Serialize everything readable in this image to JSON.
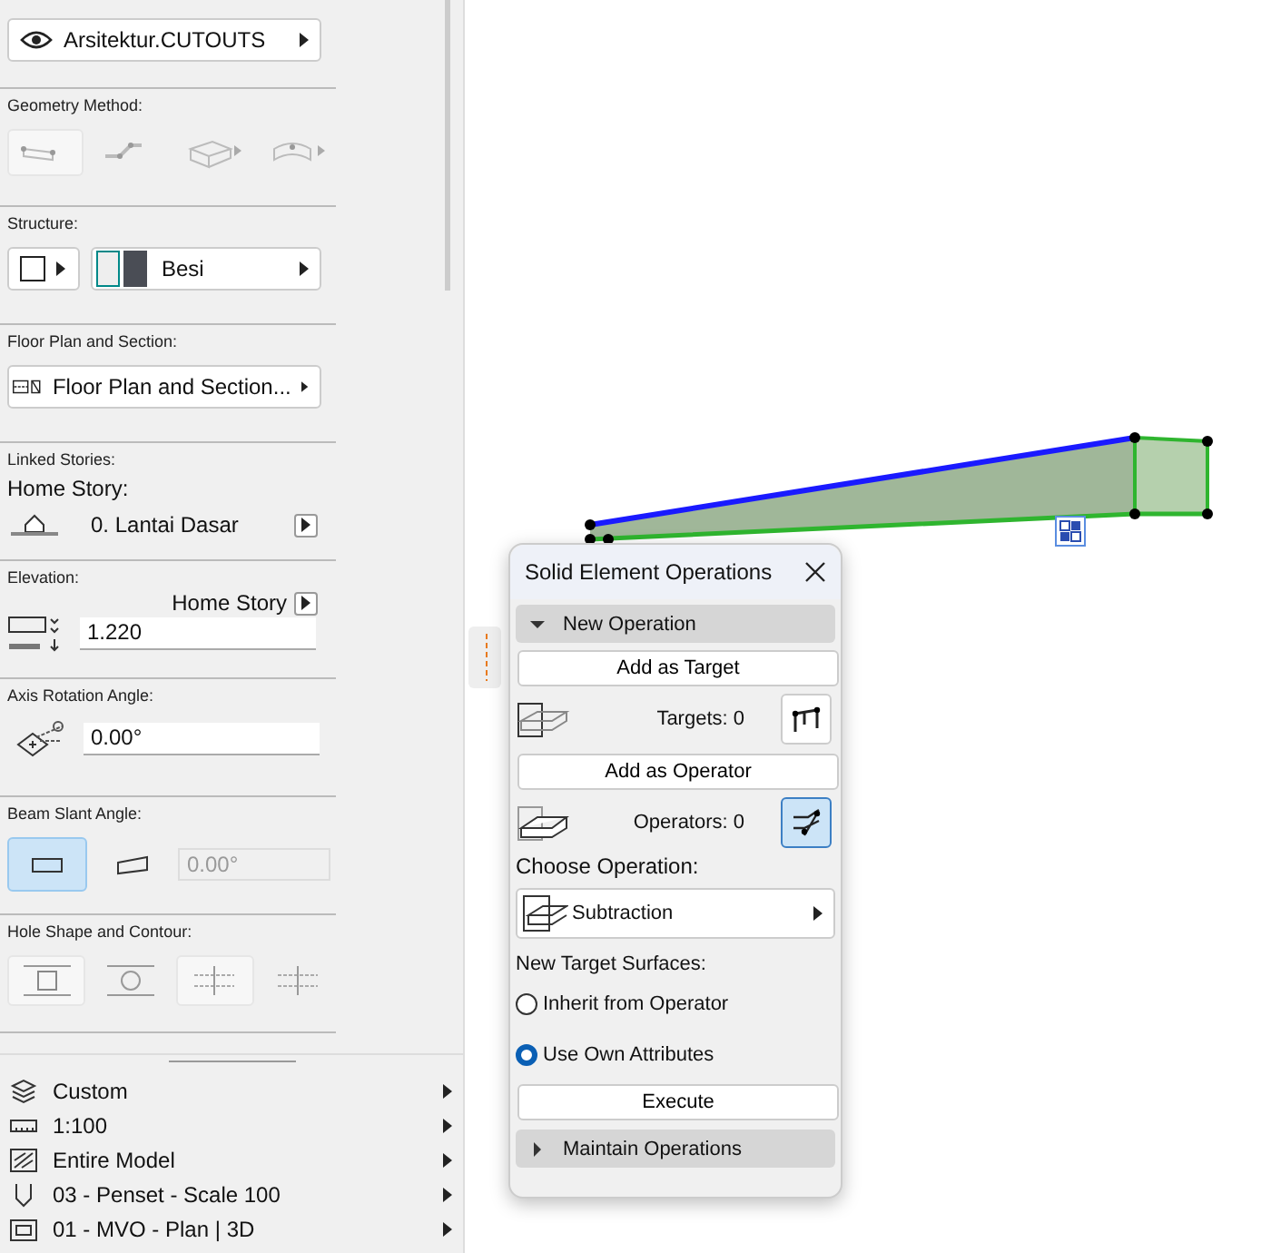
{
  "layer_selector": {
    "label": "Arsitektur.CUTOUTS"
  },
  "geometry_method": {
    "label": "Geometry Method:",
    "options": [
      {
        "kind": "straight",
        "selected": true
      },
      {
        "kind": "polyline",
        "selected": false
      },
      {
        "kind": "slanted",
        "selected": false
      },
      {
        "kind": "curved",
        "selected": false
      }
    ]
  },
  "structure": {
    "label": "Structure:",
    "material": "Besi"
  },
  "floor_plan": {
    "label": "Floor Plan and Section:",
    "value": "Floor Plan and Section..."
  },
  "linked_stories": {
    "label": "Linked Stories:",
    "home_story_label": "Home Story:",
    "story": "0. Lantai Dasar"
  },
  "elevation": {
    "label": "Elevation:",
    "reference": "Home Story",
    "value": "1.220"
  },
  "axis_rotation": {
    "label": "Axis Rotation Angle:",
    "value": "0.00°"
  },
  "beam_slant": {
    "label": "Beam Slant Angle:",
    "options": [
      {
        "kind": "vertical",
        "selected": true
      },
      {
        "kind": "slanted",
        "selected": false
      }
    ],
    "value": "0.00°",
    "value_disabled": true
  },
  "hole_shape": {
    "label": "Hole Shape and Contour:",
    "options": [
      {
        "kind": "rectangle",
        "selected": true
      },
      {
        "kind": "circle",
        "selected": false
      },
      {
        "kind": "grid",
        "selected": true
      },
      {
        "kind": "grid",
        "selected": false
      }
    ]
  },
  "view_settings": [
    {
      "kind": "layers",
      "label": "Custom"
    },
    {
      "kind": "scale",
      "label": "1:100"
    },
    {
      "kind": "model",
      "label": "Entire Model"
    },
    {
      "kind": "pen",
      "label": "03 - Penset - Scale 100"
    },
    {
      "kind": "display",
      "label": "01 - MVO - Plan | 3D"
    }
  ],
  "palette": {
    "title": "Solid Element Operations",
    "new_operation": {
      "label": "New Operation",
      "expanded": true
    },
    "add_target": "Add as Target",
    "targets": "Targets: 0",
    "target_pick_active": false,
    "add_operator": "Add as Operator",
    "operators": "Operators: 0",
    "operator_pick_active": true,
    "choose_label": "Choose Operation:",
    "operation": "Subtraction",
    "surfaces_label": "New Target Surfaces:",
    "surface_options": [
      {
        "label": "Inherit from Operator",
        "selected": false
      },
      {
        "label": "Use Own Attributes",
        "selected": true
      }
    ],
    "execute": "Execute",
    "maintain": {
      "label": "Maintain Operations",
      "expanded": false
    }
  }
}
